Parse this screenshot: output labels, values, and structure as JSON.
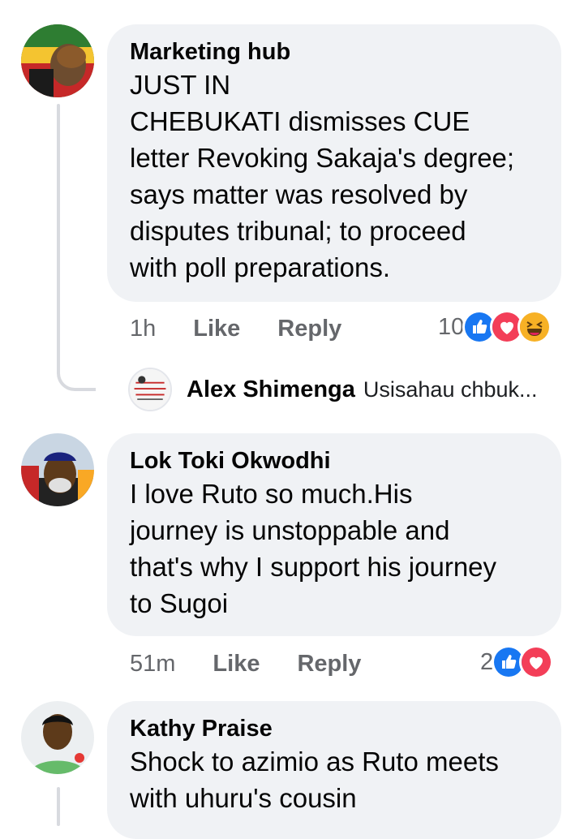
{
  "comments": [
    {
      "author": "Marketing hub",
      "text": "JUST IN\nCHEBUKATI dismisses CUE\nletter Revoking Sakaja's degree;\nsays matter was resolved by\ndisputes tribunal; to proceed\nwith poll preparations.",
      "time": "1h",
      "like_label": "Like",
      "reply_label": "Reply",
      "reaction_count": "10",
      "reactions": [
        "like-icon",
        "love-icon",
        "haha-icon"
      ],
      "reply_preview": {
        "author": "Alex Shimenga",
        "text": "Usisahau chbuk..."
      }
    },
    {
      "author": "Lok Toki Okwodhi",
      "text": "I love Ruto so much.His\njourney is unstoppable and\nthat's why I support his journey\nto Sugoi",
      "time": "51m",
      "like_label": "Like",
      "reply_label": "Reply",
      "reaction_count": "2",
      "reactions": [
        "like-icon",
        "love-icon"
      ]
    },
    {
      "author": "Kathy Praise",
      "text": "Shock to azimio as Ruto meets\nwith uhuru's cousin"
    }
  ],
  "colors": {
    "bubble": "#f0f2f5",
    "like": "#1877f2",
    "love": "#f33e58",
    "haha": "#f7b125",
    "thread_line": "#d8dadf"
  }
}
